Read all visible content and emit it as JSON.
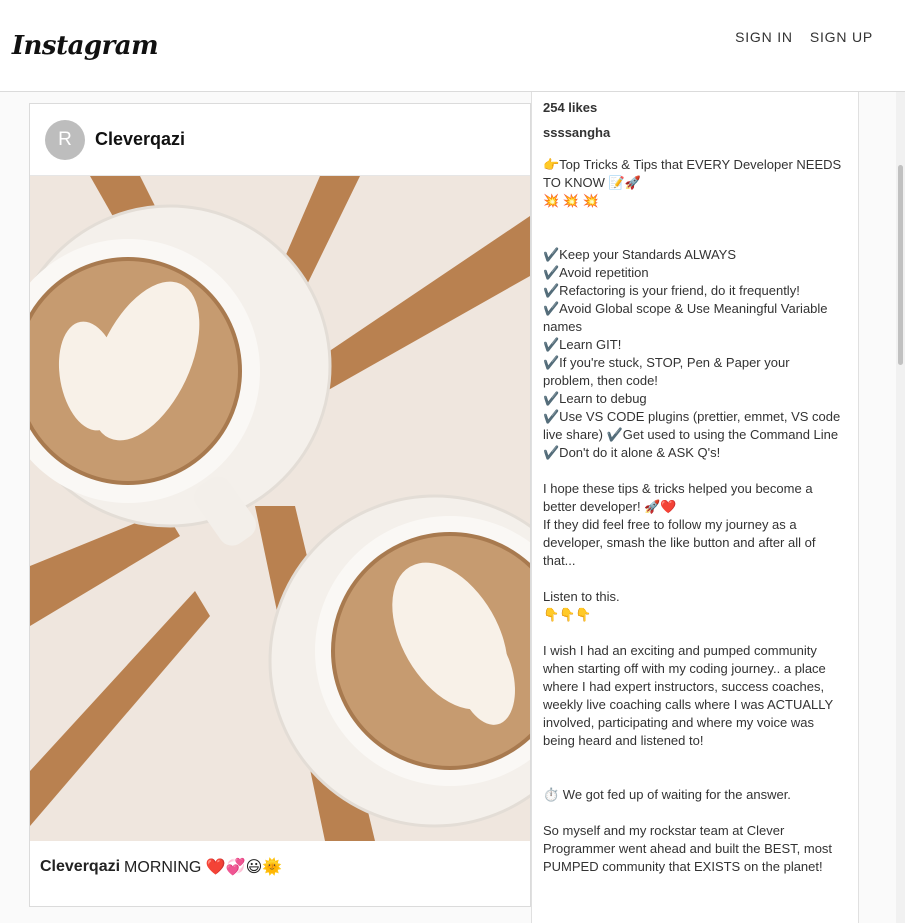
{
  "header": {
    "logo_text": "Instagram",
    "nav": {
      "sign_in": "SIGN IN",
      "sign_up": "SIGN UP"
    }
  },
  "post": {
    "avatar_letter": "R",
    "username": "Cleverqazi",
    "image": {
      "icon": "coffee-latte-photo",
      "colors": {
        "table": "#efe6de",
        "wood": "#b98150",
        "cup": "#f5f2ee",
        "coffee": "#c69b70",
        "foam": "#f8f1e8"
      }
    },
    "caption": {
      "username": "Cleverqazi",
      "text": "MORNING ❤️💞😃🌞"
    }
  },
  "sidebar": {
    "likes": "254 likes",
    "author": "ssssangha",
    "description": "👉Top Tricks & Tips that EVERY Developer NEEDS TO KNOW 📝🚀\n💥 💥 💥\n\n\n✔️Keep your Standards ALWAYS\n✔️Avoid repetition\n✔️Refactoring is your friend, do it frequently!\n✔️Avoid Global scope & Use Meaningful Variable names\n✔️Learn GIT!\n✔️If you're stuck, STOP, Pen & Paper your problem, then code!\n✔️Learn to debug\n✔️Use VS CODE plugins (prettier, emmet, VS code live share) ✔️Get used to using the Command Line\n✔️Don't do it alone & ASK Q's!\n\nI hope these tips & tricks helped you become a better developer! 🚀❤️\nIf they did feel free to follow my journey as a developer, smash the like button and after all of that...\n\nListen to this.\n👇👇👇\n\nI wish I had an exciting and pumped community when starting off with my coding journey.. a place where I had expert instructors, success coaches, weekly live coaching calls where I was ACTUALLY involved, participating and where my voice was being heard and listened to!\n\n\n⏱️ We got fed up of waiting for the answer.\n\nSo myself and my rockstar team at Clever Programmer went ahead and built the BEST, most PUMPED community that EXISTS on the planet!"
  }
}
